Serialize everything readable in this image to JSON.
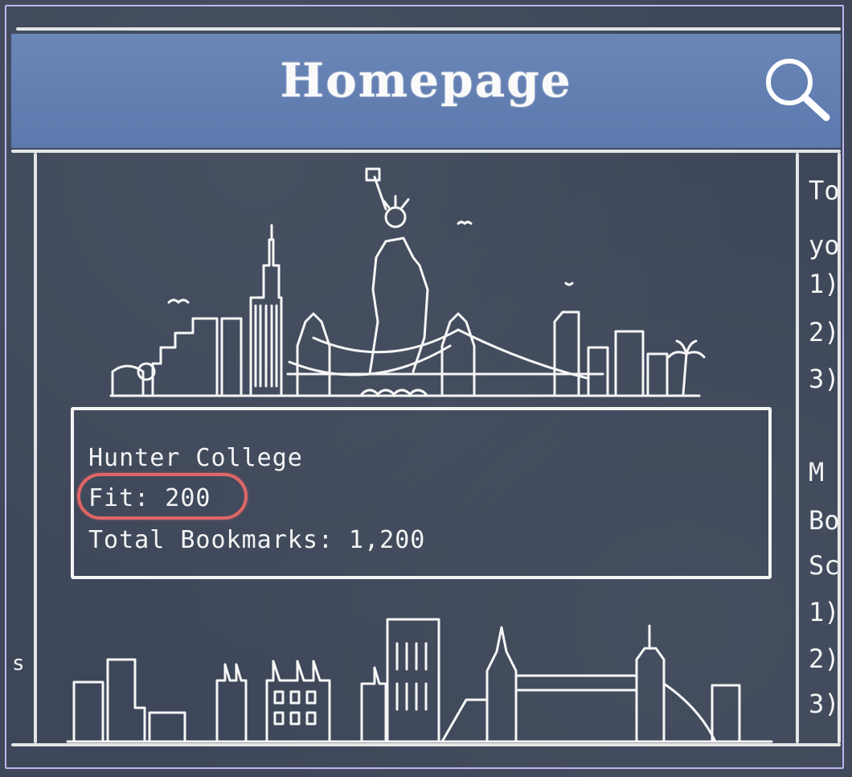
{
  "header": {
    "title": "Homepage",
    "search_icon": "search-icon"
  },
  "card": {
    "name": "Hunter College",
    "fit": "Fit: 200",
    "bookmarks": "Total Bookmarks: 1,200"
  },
  "right_panel": {
    "lines": [
      "To",
      "yo",
      "1)",
      "2)",
      "3)",
      "M",
      "Bo",
      "Sc",
      "1)",
      "2)",
      "3)"
    ]
  },
  "left_edge": {
    "text": "s"
  },
  "colors": {
    "board": "#3d4759",
    "header": "#5c79ad",
    "chalk": "#f4f4f4",
    "highlight": "#e06666",
    "frame": "#bfb4ee"
  }
}
